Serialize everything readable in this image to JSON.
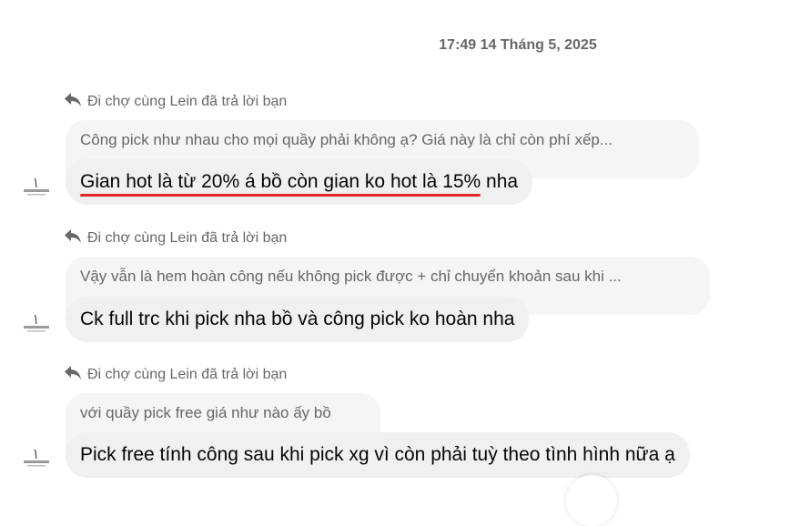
{
  "timestamp": "17:49 14 Tháng 5, 2025",
  "conversation": [
    {
      "reply_label": "Đi chợ cùng Lein đã trả lời bạn",
      "quoted": "Công pick như nhau cho mọi quầy phải không ạ? Giá này là chỉ còn phí xếp...",
      "message_highlight": "Gian hot là từ 20% á bồ còn gian ko hot là 15%",
      "message_rest": " nha"
    },
    {
      "reply_label": "Đi chợ cùng Lein đã trả lời bạn",
      "quoted": "Vậy vẫn là hem hoàn công nếu không pick được + chỉ chuyển khoản sau khi ...",
      "message": "Ck full trc khi pick nha bồ và công pick ko hoàn nha"
    },
    {
      "reply_label": "Đi chợ cùng Lein đã trả lời bạn",
      "quoted": "với quầy pick free giá như nào ấy bồ",
      "message": "Pick free tính công sau khi pick xg vì còn phải tuỳ theo tình hình nữa ạ"
    }
  ],
  "icons": {
    "reply": "reply-arrow-icon",
    "avatar": "sender-avatar"
  },
  "colors": {
    "highlight_underline": "#e0262a",
    "bubble_bg": "#f0f0f0",
    "muted_text": "#65676b"
  }
}
